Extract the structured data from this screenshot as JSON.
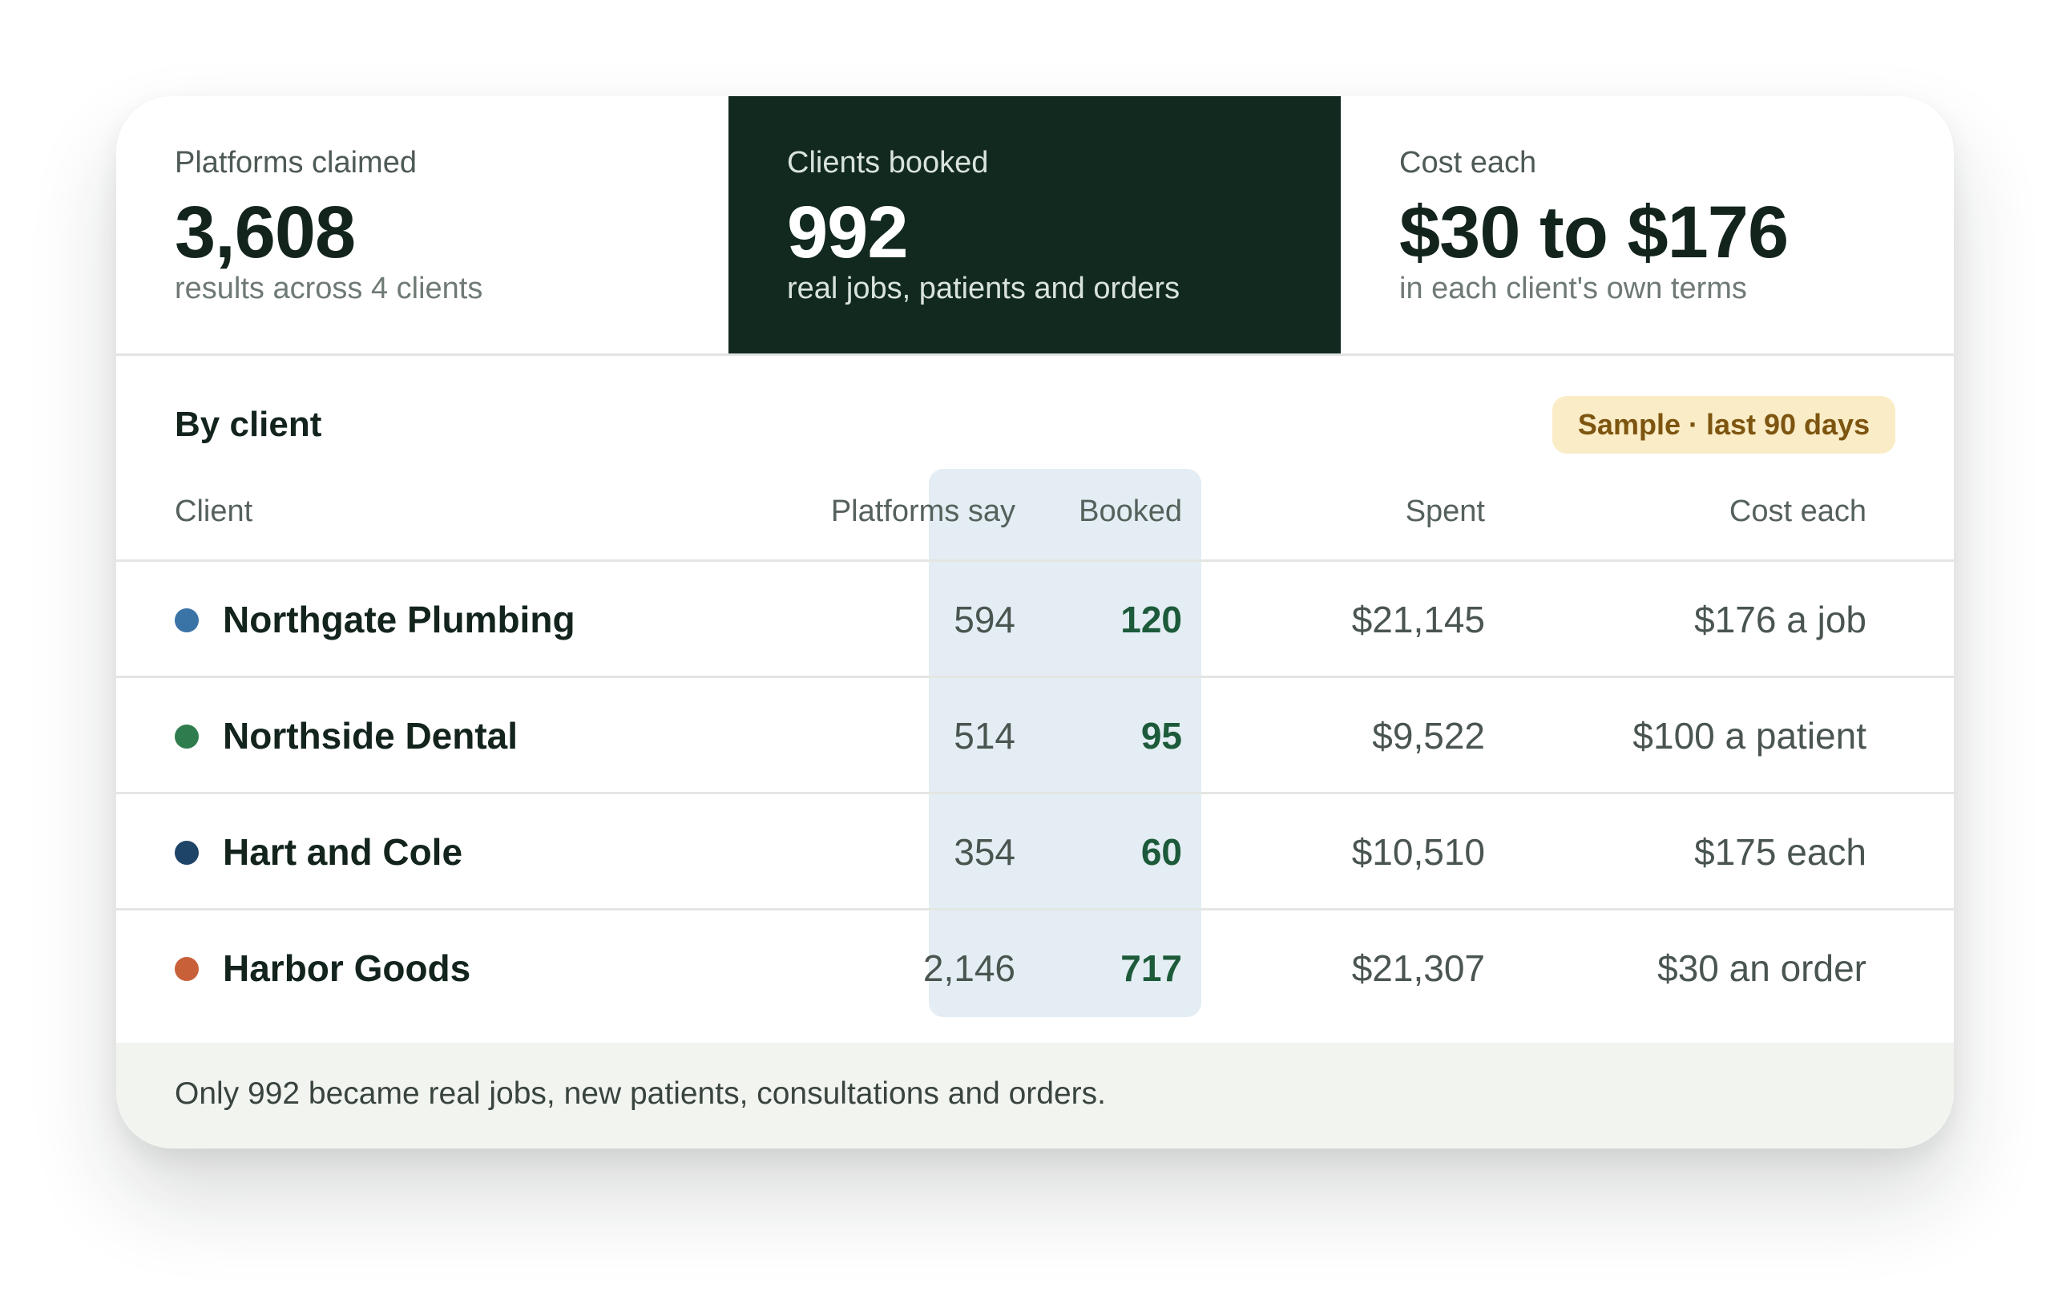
{
  "stats": [
    {
      "label": "Platforms claimed",
      "value": "3,608",
      "sub": "results across 4 clients"
    },
    {
      "label": "Clients booked",
      "value": "992",
      "sub": "real jobs, patients and orders"
    },
    {
      "label": "Cost each",
      "value": "$30 to $176",
      "sub": "in each client's own terms"
    }
  ],
  "section": {
    "title": "By client",
    "badge": "Sample · last 90 days"
  },
  "table": {
    "headers": {
      "client": "Client",
      "platforms": "Platforms say",
      "booked": "Booked",
      "spent": "Spent",
      "cost": "Cost each"
    },
    "rows": [
      {
        "client": "Northgate Plumbing",
        "platforms": "594",
        "booked": "120",
        "spent": "$21,145",
        "cost": "$176 a job"
      },
      {
        "client": "Northside Dental",
        "platforms": "514",
        "booked": "95",
        "spent": "$9,522",
        "cost": "$100 a patient"
      },
      {
        "client": "Hart and Cole",
        "platforms": "354",
        "booked": "60",
        "spent": "$10,510",
        "cost": "$175 each"
      },
      {
        "client": "Harbor Goods",
        "platforms": "2,146",
        "booked": "717",
        "spent": "$21,307",
        "cost": "$30 an order"
      }
    ]
  },
  "colors": {
    "northgate": "#3a73a6",
    "northside": "#2f7d4f",
    "hart": "#1e4568",
    "harbor": "#c8613a",
    "highlight_panel": "#122920",
    "booked_column": "#e3edf3",
    "badge_bg": "#faecc6"
  },
  "footer": {
    "note": "Only 992 became real jobs, new patients, consultations and orders."
  }
}
